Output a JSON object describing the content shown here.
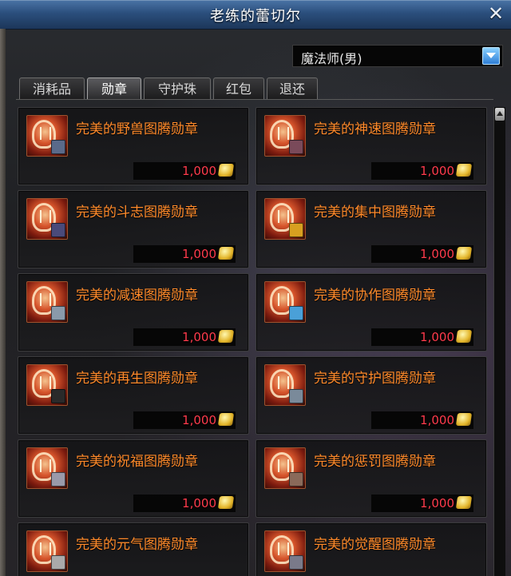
{
  "window": {
    "title": "老练的蕾切尔"
  },
  "class_select": {
    "value": "魔法师(男)"
  },
  "tabs": [
    "消耗品",
    "勋章",
    "守护珠",
    "红包",
    "退还"
  ],
  "active_tab": 1,
  "items": [
    {
      "name": "完美的野兽图腾勋章",
      "price": "1,000",
      "badge_color": "#5a6a8a"
    },
    {
      "name": "完美的神速图腾勋章",
      "price": "1,000",
      "badge_color": "#7a4a5a"
    },
    {
      "name": "完美的斗志图腾勋章",
      "price": "1,000",
      "badge_color": "#4a4a7a"
    },
    {
      "name": "完美的集中图腾勋章",
      "price": "1,000",
      "badge_color": "#d8a020"
    },
    {
      "name": "完美的减速图腾勋章",
      "price": "1,000",
      "badge_color": "#8a9aaa"
    },
    {
      "name": "完美的协作图腾勋章",
      "price": "1,000",
      "badge_color": "#4aa0d8"
    },
    {
      "name": "完美的再生图腾勋章",
      "price": "1,000",
      "badge_color": "#2a2a2a"
    },
    {
      "name": "完美的守护图腾勋章",
      "price": "1,000",
      "badge_color": "#7a8a9a"
    },
    {
      "name": "完美的祝福图腾勋章",
      "price": "1,000",
      "badge_color": "#9a9aaa"
    },
    {
      "name": "完美的惩罚图腾勋章",
      "price": "1,000",
      "badge_color": "#8a6a5a"
    },
    {
      "name": "完美的元气图腾勋章",
      "price": "1,000",
      "badge_color": "#aaaaaa"
    },
    {
      "name": "完美的觉醒图腾勋章",
      "price": "1,000",
      "badge_color": "#7a7a8a"
    }
  ],
  "icons": {
    "close": "close-icon",
    "dropdown": "chevron-down-icon",
    "item": "medal-icon",
    "currency": "gold-coin-icon",
    "scroll_up": "scroll-up-arrow-icon"
  }
}
